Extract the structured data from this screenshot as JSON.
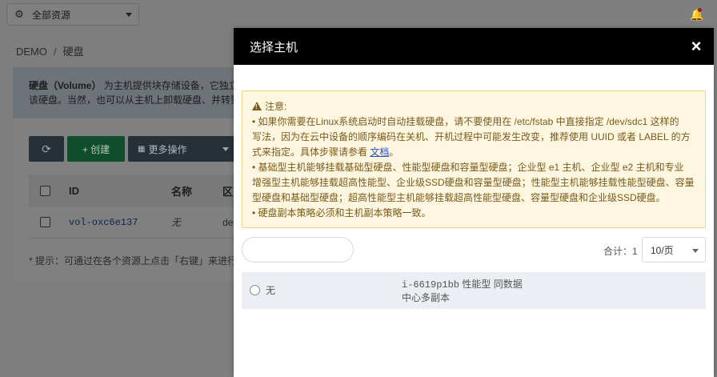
{
  "topbar": {
    "resource_select": "全部资源",
    "icons": {
      "resource": "gear-icon",
      "notifications": "bell-icon"
    }
  },
  "breadcrumb": {
    "root": "DEMO",
    "separator": "/",
    "current": "硬盘"
  },
  "intro": {
    "title": "硬盘（Volume）",
    "line1_rest": "为主机提供块存储设备，它独立",
    "line2": "该硬盘。当然，也可以从主机上卸载硬盘、并转到"
  },
  "toolbar": {
    "refresh_icon": "refresh-icon",
    "create_label": "+ 创建",
    "more_label": "更多操作"
  },
  "table": {
    "columns": [
      "ID",
      "名称",
      "区"
    ],
    "rows": [
      {
        "id": "vol-oxc6e137",
        "name": "无",
        "region": "de"
      }
    ]
  },
  "hint": "* 提示：可通过在各个资源上点击「右键」来进行",
  "modal": {
    "title": "选择主机",
    "close_label": "×",
    "notice": {
      "heading": "注意:",
      "lines": [
        "• 如果你需要在Linux系统启动时自动挂载硬盘，请不要使用在 /etc/fstab 中直接指定 /dev/sdc1 这样的",
        "写法，因为在云中设备的顺序编码在关机、开机过程中可能发生改变，推荐使用 UUID 或者 LABEL 的方",
        "• 基础型主机能够挂载基础型硬盘、性能型硬盘和容量型硬盘；企业型 e1 主机、企业型 e2 主机和专业",
        "增强型主机能够挂载超高性能型、企业级SSD硬盘和容量型硬盘；性能型主机能够挂载性能型硬盘、容量",
        "型硬盘和基础型硬盘；超高性能型主机能够挂载超高性能型硬盘、容量型硬盘和企业级SSD硬盘。",
        "• 硬盘副本策略必须和主机副本策略一致。"
      ],
      "line3_prefix": "式来指定。具体步骤请参看 ",
      "link": "文档",
      "line3_suffix": "。"
    },
    "search": {
      "placeholder": ""
    },
    "total_label": "合计：1",
    "page_size": "10/页",
    "host": {
      "name": "无",
      "id": "i-6619p1bb",
      "desc1": "性能型 同数据",
      "desc2": "中心多副本"
    }
  }
}
